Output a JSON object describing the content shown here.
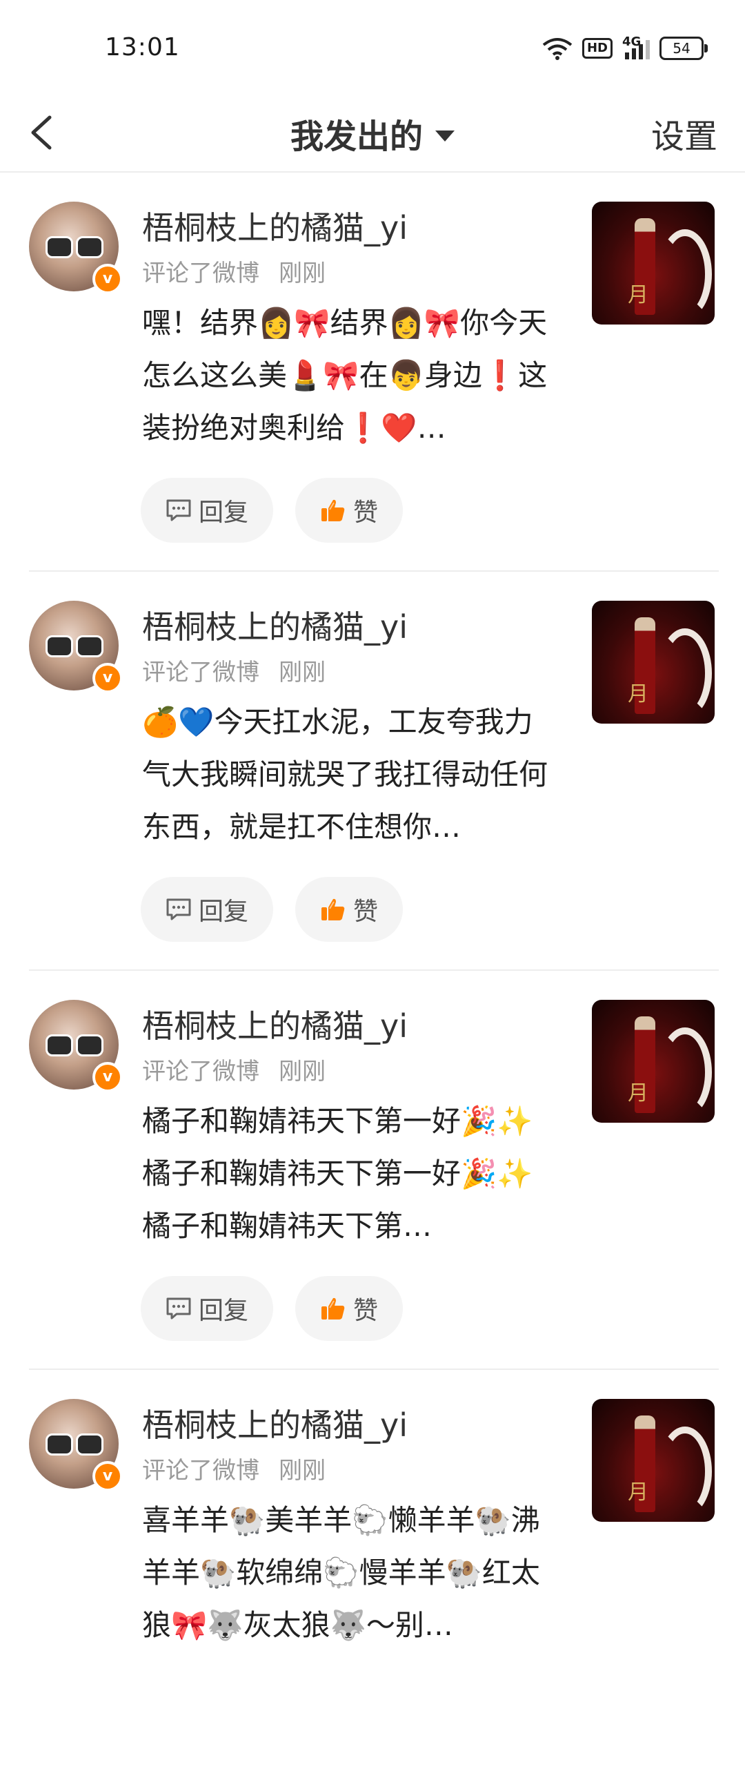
{
  "status_bar": {
    "time": "13:01",
    "network": "4G",
    "hd": "HD",
    "battery": "54"
  },
  "header": {
    "title": "我发出的",
    "settings_label": "设置"
  },
  "items": [
    {
      "name": "梧桐枝上的橘猫_yi",
      "action": "评论了微博",
      "time": "刚刚",
      "content": "嘿！结界👩🎀结界👩🎀你今天怎么这么美💄🎀在👦身边❗这装扮绝对奥利给❗❤️…",
      "reply_label": "回复",
      "like_label": "赞",
      "badge": "v"
    },
    {
      "name": "梧桐枝上的橘猫_yi",
      "action": "评论了微博",
      "time": "刚刚",
      "content": "🍊💙今天扛水泥，工友夸我力气大我瞬间就哭了我扛得动任何东西，就是扛不住想你…",
      "reply_label": "回复",
      "like_label": "赞",
      "badge": "v"
    },
    {
      "name": "梧桐枝上的橘猫_yi",
      "action": "评论了微博",
      "time": "刚刚",
      "content": "橘子和鞠婧祎天下第一好🎉✨橘子和鞠婧祎天下第一好🎉✨橘子和鞠婧祎天下第…",
      "reply_label": "回复",
      "like_label": "赞",
      "badge": "v"
    },
    {
      "name": "梧桐枝上的橘猫_yi",
      "action": "评论了微博",
      "time": "刚刚",
      "content": "喜羊羊🐏美羊羊🐑懒羊羊🐏沸羊羊🐏软绵绵🐑慢羊羊🐏红太狼🎀🐺灰太狼🐺～别…",
      "reply_label": "回复",
      "like_label": "赞",
      "badge": "v"
    }
  ],
  "icons": {
    "back": "chevron-left-icon",
    "caret": "caret-down-icon",
    "reply": "comment-icon",
    "like": "thumbs-up-icon"
  },
  "colors": {
    "accent": "#ff8200",
    "text_secondary": "#9a9a9a",
    "button_bg": "#f4f4f4"
  }
}
